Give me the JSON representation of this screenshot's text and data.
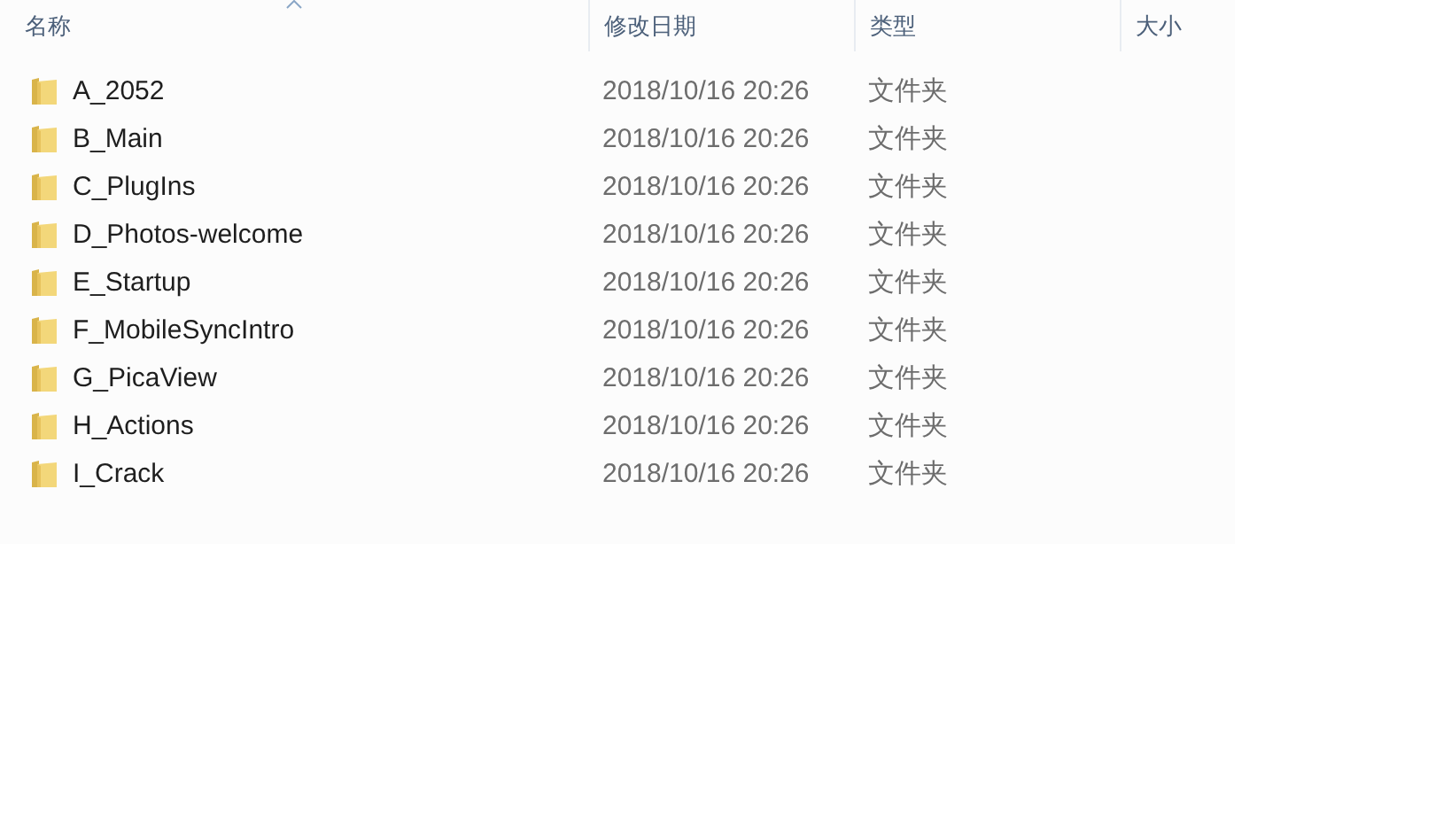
{
  "columns": [
    {
      "label": "名称",
      "sorted": true
    },
    {
      "label": "修改日期",
      "sorted": false
    },
    {
      "label": "类型",
      "sorted": false
    },
    {
      "label": "大小",
      "sorted": false
    }
  ],
  "rows": [
    {
      "name": "A_2052",
      "date": "2018/10/16 20:26",
      "type": "文件夹"
    },
    {
      "name": "B_Main",
      "date": "2018/10/16 20:26",
      "type": "文件夹"
    },
    {
      "name": "C_PlugIns",
      "date": "2018/10/16 20:26",
      "type": "文件夹"
    },
    {
      "name": "D_Photos-welcome",
      "date": "2018/10/16 20:26",
      "type": "文件夹"
    },
    {
      "name": "E_Startup",
      "date": "2018/10/16 20:26",
      "type": "文件夹"
    },
    {
      "name": "F_MobileSyncIntro",
      "date": "2018/10/16 20:26",
      "type": "文件夹"
    },
    {
      "name": "G_PicaView",
      "date": "2018/10/16 20:26",
      "type": "文件夹"
    },
    {
      "name": "H_Actions",
      "date": "2018/10/16 20:26",
      "type": "文件夹"
    },
    {
      "name": "I_Crack",
      "date": "2018/10/16 20:26",
      "type": "文件夹"
    }
  ]
}
